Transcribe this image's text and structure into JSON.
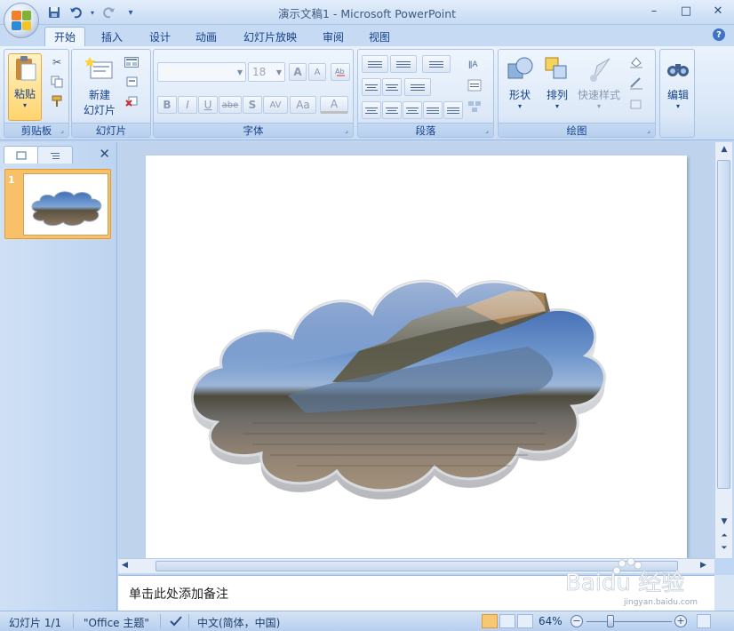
{
  "window": {
    "title": "演示文稿1 - Microsoft PowerPoint",
    "minimize": "–",
    "maximize": "□",
    "close": "✕"
  },
  "quick_access": {
    "save": "save-icon",
    "undo": "undo-icon",
    "redo": "redo-icon",
    "customize": "▾"
  },
  "tabs": [
    {
      "label": "开始",
      "active": true
    },
    {
      "label": "插入"
    },
    {
      "label": "设计"
    },
    {
      "label": "动画"
    },
    {
      "label": "幻灯片放映"
    },
    {
      "label": "审阅"
    },
    {
      "label": "视图"
    }
  ],
  "ribbon": {
    "clipboard": {
      "label": "剪贴板",
      "paste": "粘贴"
    },
    "slides": {
      "label": "幻灯片",
      "new_slide_line1": "新建",
      "new_slide_line2": "幻灯片"
    },
    "font": {
      "label": "字体",
      "font_name": "",
      "font_size": "18",
      "grow": "A",
      "shrink": "A",
      "bold": "B",
      "italic": "I",
      "underline": "U",
      "strike": "abe",
      "shadow": "S",
      "spacing": "AV",
      "case": "Aa",
      "color": "A"
    },
    "paragraph": {
      "label": "段落"
    },
    "drawing": {
      "label": "绘图",
      "shapes": "形状",
      "arrange": "排列",
      "quick_styles": "快速样式"
    },
    "editing": {
      "label": "编辑"
    }
  },
  "slides_pane": {
    "slide_number": "1"
  },
  "notes": {
    "placeholder": "单击此处添加备注"
  },
  "statusbar": {
    "slide": "幻灯片 1/1",
    "theme": "\"Office 主题\"",
    "language": "中文(简体，中国)",
    "zoom": "64%",
    "zoom_level": 0.64
  },
  "watermark": {
    "text": "Baidu 经验",
    "sub": "jingyan.baidu.com"
  },
  "colors": {
    "accent": "#15428b",
    "ribbon": "#dde9f8",
    "selection": "#f9c06a"
  }
}
